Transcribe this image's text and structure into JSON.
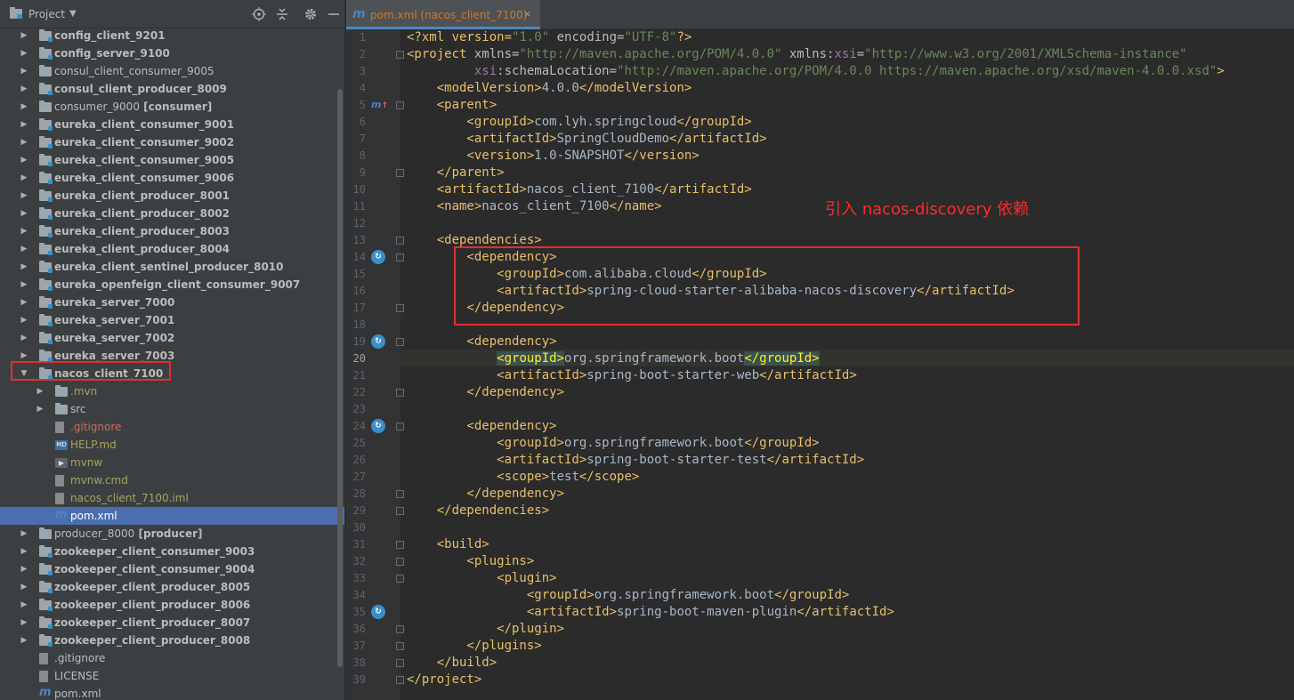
{
  "project_panel": {
    "title": "Project",
    "title_dropdown_icon": "triangle-down",
    "header_icons": [
      "locate-icon",
      "collapse-icon",
      "gear-icon",
      "minimize-icon"
    ],
    "tree": [
      {
        "label": "config_client_9201",
        "bold": true,
        "type": "module-folder",
        "expanded": false
      },
      {
        "label": "config_server_9100",
        "bold": true,
        "type": "module-folder",
        "expanded": false
      },
      {
        "label": "consul_client_consumer_9005",
        "bold": false,
        "type": "folder",
        "expanded": false
      },
      {
        "label": "consul_client_producer_8009",
        "bold": true,
        "type": "module-folder",
        "expanded": false
      },
      {
        "label": "consumer_9000",
        "suffix": "[consumer]",
        "bold": false,
        "type": "folder",
        "expanded": false
      },
      {
        "label": "eureka_client_consumer_9001",
        "bold": true,
        "type": "module-folder",
        "expanded": false
      },
      {
        "label": "eureka_client_consumer_9002",
        "bold": true,
        "type": "module-folder",
        "expanded": false
      },
      {
        "label": "eureka_client_consumer_9005",
        "bold": true,
        "type": "module-folder",
        "expanded": false
      },
      {
        "label": "eureka_client_consumer_9006",
        "bold": true,
        "type": "module-folder",
        "expanded": false
      },
      {
        "label": "eureka_client_producer_8001",
        "bold": true,
        "type": "module-folder",
        "expanded": false
      },
      {
        "label": "eureka_client_producer_8002",
        "bold": true,
        "type": "module-folder",
        "expanded": false
      },
      {
        "label": "eureka_client_producer_8003",
        "bold": true,
        "type": "module-folder",
        "expanded": false
      },
      {
        "label": "eureka_client_producer_8004",
        "bold": true,
        "type": "module-folder",
        "expanded": false
      },
      {
        "label": "eureka_client_sentinel_producer_8010",
        "bold": true,
        "type": "module-folder",
        "expanded": false
      },
      {
        "label": "eureka_openfeign_client_consumer_9007",
        "bold": true,
        "type": "module-folder",
        "expanded": false
      },
      {
        "label": "eureka_server_7000",
        "bold": true,
        "type": "module-folder",
        "expanded": false
      },
      {
        "label": "eureka_server_7001",
        "bold": true,
        "type": "module-folder",
        "expanded": false
      },
      {
        "label": "eureka_server_7002",
        "bold": true,
        "type": "module-folder",
        "expanded": false
      },
      {
        "label": "eureka_server_7003",
        "bold": true,
        "type": "module-folder",
        "expanded": false
      },
      {
        "label": "nacos_client_7100",
        "bold": true,
        "type": "module-folder",
        "expanded": true
      },
      {
        "label": ".mvn",
        "bold": false,
        "type": "folder",
        "child": true,
        "color": "olive",
        "expanded": false
      },
      {
        "label": "src",
        "bold": false,
        "type": "folder",
        "child": true,
        "expanded": false
      },
      {
        "label": ".gitignore",
        "bold": false,
        "type": "file",
        "child": true,
        "color": "red",
        "leaf": true
      },
      {
        "label": "HELP.md",
        "bold": false,
        "type": "md",
        "child": true,
        "color": "olive",
        "leaf": true
      },
      {
        "label": "mvnw",
        "bold": false,
        "type": "run",
        "child": true,
        "color": "olive",
        "leaf": true
      },
      {
        "label": "mvnw.cmd",
        "bold": false,
        "type": "file",
        "child": true,
        "color": "olive",
        "leaf": true
      },
      {
        "label": "nacos_client_7100.iml",
        "bold": false,
        "type": "file",
        "child": true,
        "color": "olive",
        "leaf": true
      },
      {
        "label": "pom.xml",
        "bold": false,
        "type": "maven",
        "child": true,
        "selected": true,
        "leaf": true
      },
      {
        "label": "producer_8000",
        "suffix": "[producer]",
        "bold": false,
        "type": "folder",
        "expanded": false
      },
      {
        "label": "zookeeper_client_consumer_9003",
        "bold": true,
        "type": "module-folder",
        "expanded": false
      },
      {
        "label": "zookeeper_client_consumer_9004",
        "bold": true,
        "type": "module-folder",
        "expanded": false
      },
      {
        "label": "zookeeper_client_producer_8005",
        "bold": true,
        "type": "module-folder",
        "expanded": false
      },
      {
        "label": "zookeeper_client_producer_8006",
        "bold": true,
        "type": "module-folder",
        "expanded": false
      },
      {
        "label": "zookeeper_client_producer_8007",
        "bold": true,
        "type": "module-folder",
        "expanded": false
      },
      {
        "label": "zookeeper_client_producer_8008",
        "bold": true,
        "type": "module-folder",
        "expanded": false
      },
      {
        "label": ".gitignore",
        "bold": false,
        "type": "file",
        "leaf": true
      },
      {
        "label": "LICENSE",
        "bold": false,
        "type": "lines",
        "leaf": true
      },
      {
        "label": "pom.xml",
        "bold": false,
        "type": "maven",
        "leaf": true
      }
    ]
  },
  "editor": {
    "tab": {
      "label": "pom.xml (nacos_client_7100)",
      "icon": "maven-icon",
      "close": "×"
    },
    "current_line": 20,
    "annotation": "引入 nacos-discovery 依赖",
    "lines": [
      [
        {
          "t": "<?xml version=",
          "c": "#e8bf6a"
        },
        {
          "t": "\"1.0\"",
          "c": "#6a8759"
        },
        {
          "t": " encoding=",
          "c": "#bababa"
        },
        {
          "t": "\"UTF-8\"",
          "c": "#6a8759"
        },
        {
          "t": "?>",
          "c": "#e8bf6a"
        }
      ],
      [
        {
          "t": "<project ",
          "c": "#e8bf6a"
        },
        {
          "t": "xmlns=",
          "c": "#bababa"
        },
        {
          "t": "\"http://maven.apache.org/POM/4.0.0\"",
          "c": "#6a8759"
        },
        {
          "t": " xmlns:",
          "c": "#bababa"
        },
        {
          "t": "xsi",
          "c": "#9876aa"
        },
        {
          "t": "=",
          "c": "#bababa"
        },
        {
          "t": "\"http://www.w3.org/2001/XMLSchema-instance\"",
          "c": "#6a8759"
        }
      ],
      [
        {
          "t": "         xsi",
          "c": "#9876aa"
        },
        {
          "t": ":schemaLocation=",
          "c": "#bababa"
        },
        {
          "t": "\"http://maven.apache.org/POM/4.0.0 https://maven.apache.org/xsd/maven-4.0.0.xsd\"",
          "c": "#6a8759"
        },
        {
          "t": ">",
          "c": "#e8bf6a"
        }
      ],
      [
        {
          "t": "    <modelVersion>",
          "c": "#e8bf6a"
        },
        {
          "t": "4.0.0",
          "c": "#a9b7c6"
        },
        {
          "t": "</modelVersion>",
          "c": "#e8bf6a"
        }
      ],
      [
        {
          "t": "    <parent>",
          "c": "#e8bf6a"
        }
      ],
      [
        {
          "t": "        <groupId>",
          "c": "#e8bf6a"
        },
        {
          "t": "com.lyh.springcloud",
          "c": "#a9b7c6"
        },
        {
          "t": "</groupId>",
          "c": "#e8bf6a"
        }
      ],
      [
        {
          "t": "        <artifactId>",
          "c": "#e8bf6a"
        },
        {
          "t": "SpringCloudDemo",
          "c": "#a9b7c6"
        },
        {
          "t": "</artifactId>",
          "c": "#e8bf6a"
        }
      ],
      [
        {
          "t": "        <version>",
          "c": "#e8bf6a"
        },
        {
          "t": "1.0-SNAPSHOT",
          "c": "#a9b7c6"
        },
        {
          "t": "</version>",
          "c": "#e8bf6a"
        }
      ],
      [
        {
          "t": "    </parent>",
          "c": "#e8bf6a"
        }
      ],
      [
        {
          "t": "    <artifactId>",
          "c": "#e8bf6a"
        },
        {
          "t": "nacos_client_7100",
          "c": "#a9b7c6"
        },
        {
          "t": "</artifactId>",
          "c": "#e8bf6a"
        }
      ],
      [
        {
          "t": "    <name>",
          "c": "#e8bf6a"
        },
        {
          "t": "nacos_client_7100",
          "c": "#a9b7c6"
        },
        {
          "t": "</name>",
          "c": "#e8bf6a"
        }
      ],
      [],
      [
        {
          "t": "    <dependencies>",
          "c": "#e8bf6a"
        }
      ],
      [
        {
          "t": "        <dependency>",
          "c": "#e8bf6a"
        }
      ],
      [
        {
          "t": "            <groupId>",
          "c": "#e8bf6a"
        },
        {
          "t": "com.alibaba.cloud",
          "c": "#a9b7c6"
        },
        {
          "t": "</groupId>",
          "c": "#e8bf6a"
        }
      ],
      [
        {
          "t": "            <artifactId>",
          "c": "#e8bf6a"
        },
        {
          "t": "spring-cloud-starter-alibaba-nacos-discovery",
          "c": "#a9b7c6"
        },
        {
          "t": "</artifactId>",
          "c": "#e8bf6a"
        }
      ],
      [
        {
          "t": "        </dependency>",
          "c": "#e8bf6a"
        }
      ],
      [],
      [
        {
          "t": "        <dependency>",
          "c": "#e8bf6a"
        }
      ],
      [
        {
          "t": "            ",
          "c": "#a9b7c6"
        },
        {
          "t": "<groupId>",
          "c": "#e8bf6a",
          "hl": true
        },
        {
          "t": "org.springframework.boot",
          "c": "#a9b7c6"
        },
        {
          "t": "</groupId>",
          "c": "#e8bf6a",
          "hl": true
        }
      ],
      [
        {
          "t": "            <artifactId>",
          "c": "#e8bf6a"
        },
        {
          "t": "spring-boot-starter-web",
          "c": "#a9b7c6"
        },
        {
          "t": "</artifactId>",
          "c": "#e8bf6a"
        }
      ],
      [
        {
          "t": "        </dependency>",
          "c": "#e8bf6a"
        }
      ],
      [],
      [
        {
          "t": "        <dependency>",
          "c": "#e8bf6a"
        }
      ],
      [
        {
          "t": "            <groupId>",
          "c": "#e8bf6a"
        },
        {
          "t": "org.springframework.boot",
          "c": "#a9b7c6"
        },
        {
          "t": "</groupId>",
          "c": "#e8bf6a"
        }
      ],
      [
        {
          "t": "            <artifactId>",
          "c": "#e8bf6a"
        },
        {
          "t": "spring-boot-starter-test",
          "c": "#a9b7c6"
        },
        {
          "t": "</artifactId>",
          "c": "#e8bf6a"
        }
      ],
      [
        {
          "t": "            <scope>",
          "c": "#e8bf6a"
        },
        {
          "t": "test",
          "c": "#a9b7c6"
        },
        {
          "t": "</scope>",
          "c": "#e8bf6a"
        }
      ],
      [
        {
          "t": "        </dependency>",
          "c": "#e8bf6a"
        }
      ],
      [
        {
          "t": "    </dependencies>",
          "c": "#e8bf6a"
        }
      ],
      [],
      [
        {
          "t": "    <build>",
          "c": "#e8bf6a"
        }
      ],
      [
        {
          "t": "        <plugins>",
          "c": "#e8bf6a"
        }
      ],
      [
        {
          "t": "            <plugin>",
          "c": "#e8bf6a"
        }
      ],
      [
        {
          "t": "                <groupId>",
          "c": "#e8bf6a"
        },
        {
          "t": "org.springframework.boot",
          "c": "#a9b7c6"
        },
        {
          "t": "</groupId>",
          "c": "#e8bf6a"
        }
      ],
      [
        {
          "t": "                <artifactId>",
          "c": "#e8bf6a"
        },
        {
          "t": "spring-boot-maven-plugin",
          "c": "#a9b7c6"
        },
        {
          "t": "</artifactId>",
          "c": "#e8bf6a"
        }
      ],
      [
        {
          "t": "            </plugin>",
          "c": "#e8bf6a"
        }
      ],
      [
        {
          "t": "        </plugins>",
          "c": "#e8bf6a"
        }
      ],
      [
        {
          "t": "    </build>",
          "c": "#e8bf6a"
        }
      ],
      [
        {
          "t": "</project>",
          "c": "#e8bf6a"
        }
      ]
    ],
    "gutter_markers": [
      {
        "line": 5,
        "icon": "maven-parent-icon",
        "symbol": "m",
        "arrow": "↑"
      },
      {
        "line": 14,
        "icon": "dependency-refresh-icon",
        "symbol": "↻"
      },
      {
        "line": 19,
        "icon": "dependency-refresh-icon",
        "symbol": "↻"
      },
      {
        "line": 24,
        "icon": "dependency-refresh-icon",
        "symbol": "↻"
      },
      {
        "line": 35,
        "icon": "plugin-refresh-icon",
        "symbol": "↻"
      }
    ],
    "fold_lines": [
      2,
      5,
      9,
      13,
      14,
      17,
      19,
      22,
      24,
      28,
      29,
      31,
      32,
      33,
      36,
      37,
      38,
      39
    ],
    "colors": {
      "tag": "#e8bf6a",
      "string": "#6a8759",
      "text": "#a9b7c6",
      "namespace": "#9876aa",
      "annotation": "#ff2a2a",
      "box": "#e03030"
    }
  }
}
